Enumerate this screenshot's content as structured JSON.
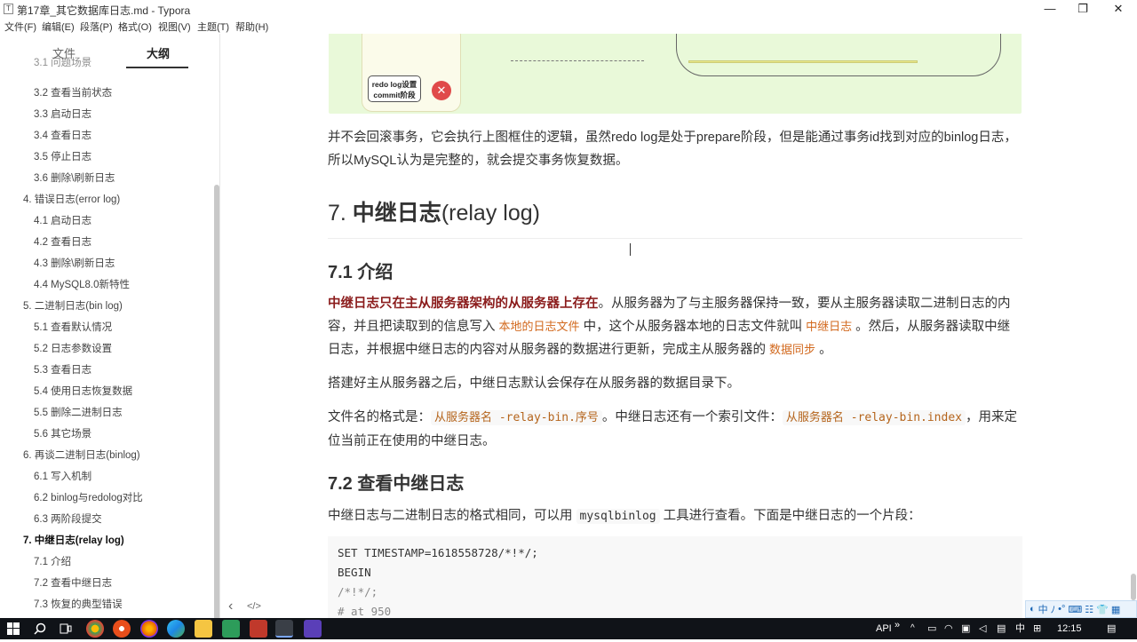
{
  "window": {
    "title": "第17章_其它数据库日志.md - Typora",
    "icon_letter": "T",
    "controls": {
      "minimize": "—",
      "maximize": "❐",
      "close": "✕"
    }
  },
  "menu": [
    "文件(F)",
    "编辑(E)",
    "段落(P)",
    "格式(O)",
    "视图(V)",
    "主题(T)",
    "帮助(H)"
  ],
  "sidebar": {
    "tab_files": "文件",
    "tab_outline": "大纲",
    "items": [
      {
        "label": "3.1 问题场景",
        "level": 2
      },
      {
        "label": "3.2 查看当前状态",
        "level": 2
      },
      {
        "label": "3.3 启动日志",
        "level": 2
      },
      {
        "label": "3.4 查看日志",
        "level": 2
      },
      {
        "label": "3.5 停止日志",
        "level": 2
      },
      {
        "label": "3.6 删除\\刷新日志",
        "level": 2
      },
      {
        "label": "4. 错误日志(error log)",
        "level": 1
      },
      {
        "label": "4.1 启动日志",
        "level": 2
      },
      {
        "label": "4.2 查看日志",
        "level": 2
      },
      {
        "label": "4.3 删除\\刷新日志",
        "level": 2
      },
      {
        "label": "4.4 MySQL8.0新特性",
        "level": 2
      },
      {
        "label": "5. 二进制日志(bin log)",
        "level": 1
      },
      {
        "label": "5.1 查看默认情况",
        "level": 2
      },
      {
        "label": "5.2 日志参数设置",
        "level": 2
      },
      {
        "label": "5.3 查看日志",
        "level": 2
      },
      {
        "label": "5.4 使用日志恢复数据",
        "level": 2
      },
      {
        "label": "5.5 删除二进制日志",
        "level": 2
      },
      {
        "label": "5.6 其它场景",
        "level": 2
      },
      {
        "label": "6. 再谈二进制日志(binlog)",
        "level": 1
      },
      {
        "label": "6.1 写入机制",
        "level": 2
      },
      {
        "label": "6.2 binlog与redolog对比",
        "level": 2
      },
      {
        "label": "6.3 两阶段提交",
        "level": 2
      },
      {
        "label": "7. 中继日志(relay log)",
        "level": 1,
        "active": true
      },
      {
        "label": "7.1 介绍",
        "level": 2
      },
      {
        "label": "7.2 查看中继日志",
        "level": 2
      },
      {
        "label": "7.3 恢复的典型错误",
        "level": 2
      }
    ],
    "footer_back": "‹",
    "footer_source": "</>"
  },
  "figure": {
    "stage_label_line1": "redo log设置",
    "stage_label_line2": "commit阶段",
    "x_mark": "✕"
  },
  "content": {
    "para_intro": "并不会回滚事务，它会执行上图框住的逻辑，虽然redo log是处于prepare阶段，但是能通过事务id找到对应的binlog日志，所以MySQL认为是完整的，就会提交事务恢复数据。",
    "h1_prefix": "7. ",
    "h1_bold": "中继日志",
    "h1_suffix": "(relay log)",
    "h2_1": "7.1 介绍",
    "p1_bold": "中继日志只在主从服务器架构的从服务器上存在",
    "p1_a": "。从服务器为了与主服务器保持一致，要从主服务器读取二进制日志的内容，并且把读取到的信息写入 ",
    "p1_code1": "本地的日志文件",
    "p1_b": " 中，这个从服务器本地的日志文件就叫 ",
    "p1_code2": "中继日志",
    "p1_c": " 。然后，从服务器读取中继日志，并根据中继日志的内容对从服务器的数据进行更新，完成主从服务器的 ",
    "p1_code3": "数据同步",
    "p1_d": " 。",
    "p2": "搭建好主从服务器之后，中继日志默认会保存在从服务器的数据目录下。",
    "p3_a": "文件名的格式是：",
    "p3_code1": "从服务器名 -relay-bin.序号",
    "p3_b": "。中继日志还有一个索引文件：",
    "p3_code2": "从服务器名 -relay-bin.index",
    "p3_c": "，用来定位当前正在使用的中继日志。",
    "h2_2": "7.2 查看中继日志",
    "p4_a": "中继日志与二进制日志的格式相同，可以用 ",
    "p4_code": "mysqlbinlog",
    "p4_b": " 工具进行查看。下面是中继日志的一个片段：",
    "code_lines": [
      "SET TIMESTAMP=1618558728/*!*/;",
      "BEGIN",
      "/*!*/;",
      "# at 950"
    ]
  },
  "ime": {
    "items": [
      "中",
      "ﾉ",
      "•°",
      "⌨",
      "☷",
      "👕",
      "▦"
    ]
  },
  "taskbar": {
    "tray_api": "API",
    "tray_chevron": "»",
    "tray_lang": "中",
    "tray_time": "12:15"
  },
  "colors": {
    "accent_red": "#8b1c1c",
    "code_orange": "#b5651d",
    "figure_bg": "#e9f9d9"
  }
}
